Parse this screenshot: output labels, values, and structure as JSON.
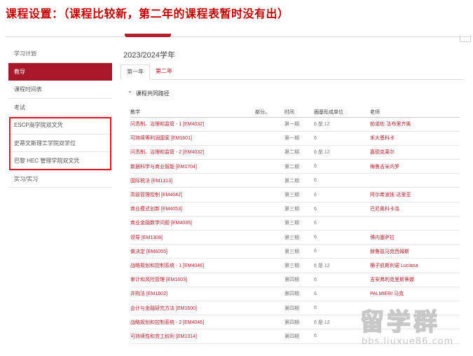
{
  "headline": "课程设置：（课程比较新，第二年的课程表暂时没有出）",
  "sidebar": {
    "items": [
      {
        "label": "学习计划",
        "active": false
      },
      {
        "label": "教导",
        "active": true
      },
      {
        "label": "课程时间表",
        "active": false
      },
      {
        "label": "考试",
        "active": false
      },
      {
        "label": "ESCP商学院双文凭",
        "active": false
      },
      {
        "label": "史蒂文斯理工学院双学位",
        "active": false
      },
      {
        "label": "巴黎 HEC 管理学院双文凭",
        "active": false
      },
      {
        "label": "实习/实习",
        "active": false
      }
    ]
  },
  "main": {
    "year": "2023/2024学年",
    "tabs": [
      {
        "label": "第一年",
        "active": true
      },
      {
        "label": "第二年",
        "active": false
      }
    ],
    "section_title": "课程共同路径",
    "table": {
      "headers": [
        "教学",
        "部分。",
        "时间",
        "圈基形成单位",
        "老师"
      ],
      "rows": [
        {
          "course": "问责制、治理和监管 - 1 [EM4032]",
          "part": "",
          "term": "第一期",
          "credits": "6 是 12",
          "teacher": "帕诺佐·法布里齐奥"
        },
        {
          "course": "可持续等利润国家 [EM1601]",
          "part": "",
          "term": "第一期",
          "credits": "6",
          "teacher": "禾大恩科卡"
        },
        {
          "course": "问责制、治理和监管 - 2 [EM4032]",
          "part": "",
          "term": "第二期",
          "credits": "6 是 12",
          "teacher": "嘉德克莱尔"
        },
        {
          "course": "数据科学与商业智能 [EM1704]",
          "part": "",
          "term": "第二期",
          "credits": "6",
          "teacher": "梅鲁吉米内罗"
        },
        {
          "course": "国际税法 [EM1313]",
          "part": "",
          "term": "第二期",
          "credits": "6",
          "teacher": ""
        },
        {
          "course": "高级管理控制 [EM4042]",
          "part": "",
          "term": "第三期",
          "credits": "6",
          "teacher": "阿尔希波娃·达里亚"
        },
        {
          "course": "商业模式创新 [EM4053]",
          "part": "",
          "term": "第三期",
          "credits": "6",
          "teacher": "巴尼奥科卡洛"
        },
        {
          "course": "商业金融数学问题 [EM4035]",
          "part": "",
          "term": "第三期",
          "credits": "6",
          "teacher": ""
        },
        {
          "course": "领导 [EM1308]",
          "part": "",
          "term": "第三期",
          "credits": "6",
          "teacher": "博内塞萨拉"
        },
        {
          "course": "做决定 [EM6055]",
          "part": "",
          "term": "第三期",
          "credits": "6",
          "teacher": "赫鲁兹马克西姆斯"
        },
        {
          "course": "战略规划和控制系统 - 1 [EM4046]",
          "part": "",
          "term": "第三期",
          "credits": "6 是 12",
          "teacher": "横子凯斯利诺 Luciana"
        },
        {
          "course": "审计和风险管理 [EM1603]",
          "part": "",
          "term": "第四期",
          "credits": "6",
          "teacher": "吉安弗利克里斯蒂娜"
        },
        {
          "course": "并购法 [EM1602]",
          "part": "",
          "term": "第四期",
          "credits": "6",
          "teacher": "PALMIERI 马克"
        },
        {
          "course": "会计与金融研究方法 [EM1600]",
          "part": "",
          "term": "第四期",
          "credits": "6",
          "teacher": ""
        },
        {
          "course": "战略规划和控制系统 - 2 [EM4046]",
          "part": "",
          "term": "第四期",
          "credits": "6 是 12",
          "teacher": ""
        },
        {
          "course": "可持续性和劳工权利 [EM1314]",
          "part": "",
          "term": "第四期",
          "credits": "6",
          "teacher": ""
        }
      ]
    }
  },
  "watermark": {
    "logo_text": "留学群",
    "url_text": "bbs.liuxue86.com"
  },
  "colors": {
    "accent": "#b3202d",
    "active_bg": "#a8182a",
    "highlight": "#e0121d"
  }
}
